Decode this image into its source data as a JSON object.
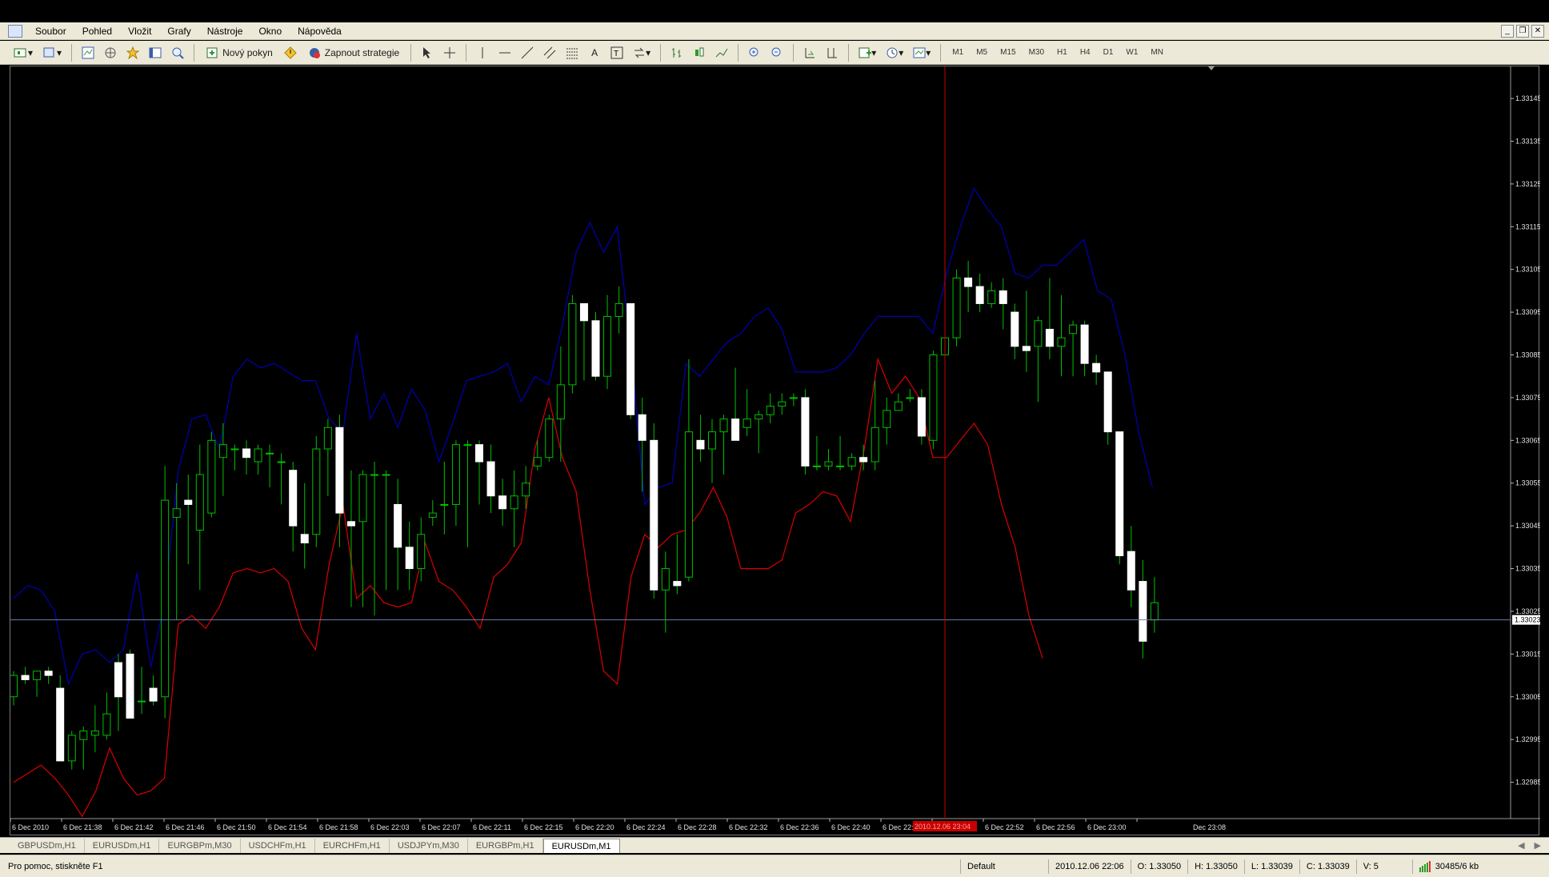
{
  "menubar": {
    "items": [
      "Soubor",
      "Pohled",
      "Vložit",
      "Grafy",
      "Nástroje",
      "Okno",
      "Nápověda"
    ],
    "window_controls": [
      "_",
      "❐",
      "✕"
    ]
  },
  "toolbar": {
    "new_order_label": "Nový pokyn",
    "strategy_label": "Zapnout strategie",
    "timeframes": [
      "M1",
      "M5",
      "M15",
      "M30",
      "H1",
      "H4",
      "D1",
      "W1",
      "MN"
    ]
  },
  "tabs": [
    "GBPUSDm,H1",
    "EURUSDm,H1",
    "EURGBPm,M30",
    "USDCHFm,H1",
    "EURCHFm,H1",
    "USDJPYm,M30",
    "EURGBPm,H1",
    "EURUSDm,M1"
  ],
  "active_tab": 7,
  "status": {
    "help": "Pro pomoc, stiskněte F1",
    "profile": "Default",
    "datetime": "2010.12.06 22:06",
    "open": "O: 1.33050",
    "high": "H: 1.33050",
    "low": "L: 1.33039",
    "close": "C: 1.33039",
    "volume": "V: 5",
    "traffic": "30485/6 kb"
  },
  "colors": {
    "bull_candle": "#00c000",
    "bear_body": "#ffffff",
    "upper_band": "#0000b4",
    "lower_band": "#dc0000",
    "price_line": "#6a7fa8",
    "cursor_line": "#c80000"
  },
  "chart_data": {
    "type": "candlestick",
    "symbol": "EURUSDm",
    "timeframe": "M1",
    "y_ticks": [
      "1.33145",
      "1.33135",
      "1.33125",
      "1.33115",
      "1.33105",
      "1.33095",
      "1.33085",
      "1.33075",
      "1.33065",
      "1.33055",
      "1.33045",
      "1.33035",
      "1.33025",
      "1.33015",
      "1.33005",
      "1.32995",
      "1.32985"
    ],
    "x_ticks": [
      "6 Dec 2010",
      "6 Dec 21:38",
      "6 Dec 21:42",
      "6 Dec 21:46",
      "6 Dec 21:50",
      "6 Dec 21:54",
      "6 Dec 21:58",
      "6 Dec 22:03",
      "6 Dec 22:07",
      "6 Dec 22:11",
      "6 Dec 22:15",
      "6 Dec 22:20",
      "6 Dec 22:24",
      "6 Dec 22:28",
      "6 Dec 22:32",
      "6 Dec 22:36",
      "6 Dec 22:40",
      "6 Dec 22:44",
      "6 Dec 22:48",
      "6 Dec 22:52",
      "6 Dec 22:56",
      "6 Dec 23:00",
      "Dec 23:08"
    ],
    "current_price": "1.33023",
    "cursor_time_label": "2010.12.06 23:04",
    "candles": [
      [
        1.33005,
        1.33011,
        1.33003,
        1.3301
      ],
      [
        1.3301,
        1.33012,
        1.33008,
        1.33009
      ],
      [
        1.33009,
        1.33011,
        1.33005,
        1.33011
      ],
      [
        1.33011,
        1.33012,
        1.33008,
        1.3301
      ],
      [
        1.33007,
        1.3301,
        1.3299,
        1.3299
      ],
      [
        1.3299,
        1.32997,
        1.32988,
        1.32996
      ],
      [
        1.32995,
        1.32998,
        1.32988,
        1.32997
      ],
      [
        1.32996,
        1.33003,
        1.32992,
        1.32997
      ],
      [
        1.32996,
        1.33006,
        1.32995,
        1.33001
      ],
      [
        1.33013,
        1.33015,
        1.32997,
        1.33005
      ],
      [
        1.33015,
        1.33016,
        1.33001,
        1.33
      ],
      [
        1.33004,
        1.33012,
        1.33001,
        1.33004
      ],
      [
        1.33007,
        1.3301,
        1.33003,
        1.33004
      ],
      [
        1.33005,
        1.33059,
        1.33,
        1.33051
      ],
      [
        1.33047,
        1.33055,
        1.33023,
        1.33049
      ],
      [
        1.33051,
        1.33057,
        1.33036,
        1.3305
      ],
      [
        1.33044,
        1.33064,
        1.3303,
        1.33057
      ],
      [
        1.33048,
        1.33067,
        1.33047,
        1.33065
      ],
      [
        1.33061,
        1.33069,
        1.33052,
        1.33064
      ],
      [
        1.33063,
        1.33064,
        1.33058,
        1.33063
      ],
      [
        1.33063,
        1.33065,
        1.33057,
        1.33061
      ],
      [
        1.3306,
        1.33064,
        1.33057,
        1.33063
      ],
      [
        1.33062,
        1.33064,
        1.33054,
        1.33062
      ],
      [
        1.3306,
        1.33062,
        1.3305,
        1.3306
      ],
      [
        1.33058,
        1.3306,
        1.33039,
        1.33045
      ],
      [
        1.33043,
        1.33055,
        1.33035,
        1.33041
      ],
      [
        1.33043,
        1.33066,
        1.3304,
        1.33063
      ],
      [
        1.33063,
        1.3307,
        1.33052,
        1.33068
      ],
      [
        1.33068,
        1.33071,
        1.3304,
        1.33048
      ],
      [
        1.33046,
        1.33058,
        1.33026,
        1.33045
      ],
      [
        1.33046,
        1.33058,
        1.33026,
        1.33057
      ],
      [
        1.33057,
        1.3306,
        1.33024,
        1.33057
      ],
      [
        1.33057,
        1.33058,
        1.3303,
        1.33057
      ],
      [
        1.3305,
        1.33056,
        1.3303,
        1.3304
      ],
      [
        1.3304,
        1.33046,
        1.3303,
        1.33035
      ],
      [
        1.33035,
        1.33047,
        1.33032,
        1.33043
      ],
      [
        1.33047,
        1.33051,
        1.33045,
        1.33048
      ],
      [
        1.3305,
        1.3306,
        1.33043,
        1.3305
      ],
      [
        1.3305,
        1.33065,
        1.33045,
        1.33064
      ],
      [
        1.33064,
        1.33065,
        1.3304,
        1.33064
      ],
      [
        1.33064,
        1.33065,
        1.3305,
        1.3306
      ],
      [
        1.3306,
        1.33064,
        1.33048,
        1.33052
      ],
      [
        1.33052,
        1.33056,
        1.33045,
        1.33049
      ],
      [
        1.33049,
        1.33058,
        1.3304,
        1.33052
      ],
      [
        1.33052,
        1.33059,
        1.33049,
        1.33055
      ],
      [
        1.33059,
        1.33065,
        1.33058,
        1.33061
      ],
      [
        1.33061,
        1.33071,
        1.3306,
        1.3307
      ],
      [
        1.3307,
        1.33087,
        1.3306,
        1.33078
      ],
      [
        1.33078,
        1.33099,
        1.33076,
        1.33097
      ],
      [
        1.33097,
        1.33097,
        1.33079,
        1.33093
      ],
      [
        1.33093,
        1.33095,
        1.33079,
        1.3308
      ],
      [
        1.3308,
        1.33099,
        1.33077,
        1.33094
      ],
      [
        1.33094,
        1.33101,
        1.3309,
        1.33097
      ],
      [
        1.33097,
        1.33097,
        1.3307,
        1.33071
      ],
      [
        1.33071,
        1.33075,
        1.33053,
        1.33065
      ],
      [
        1.33065,
        1.33069,
        1.33028,
        1.3303
      ],
      [
        1.3303,
        1.33039,
        1.3302,
        1.33035
      ],
      [
        1.33032,
        1.33043,
        1.33029,
        1.33031
      ],
      [
        1.33033,
        1.33084,
        1.33032,
        1.33067
      ],
      [
        1.33065,
        1.33071,
        1.3306,
        1.33063
      ],
      [
        1.33063,
        1.3307,
        1.33055,
        1.33067
      ],
      [
        1.33067,
        1.33071,
        1.33057,
        1.3307
      ],
      [
        1.3307,
        1.33082,
        1.33068,
        1.33065
      ],
      [
        1.33068,
        1.33077,
        1.33066,
        1.3307
      ],
      [
        1.3307,
        1.33072,
        1.33062,
        1.33071
      ],
      [
        1.33071,
        1.33076,
        1.33069,
        1.33073
      ],
      [
        1.33073,
        1.33076,
        1.33071,
        1.33074
      ],
      [
        1.33075,
        1.33076,
        1.33073,
        1.33075
      ],
      [
        1.33075,
        1.33077,
        1.33057,
        1.33059
      ],
      [
        1.33059,
        1.33066,
        1.33058,
        1.33059
      ],
      [
        1.33059,
        1.33063,
        1.33058,
        1.3306
      ],
      [
        1.33059,
        1.33066,
        1.33058,
        1.33059
      ],
      [
        1.33059,
        1.33062,
        1.33058,
        1.33061
      ],
      [
        1.33061,
        1.33064,
        1.33058,
        1.3306
      ],
      [
        1.3306,
        1.33079,
        1.33058,
        1.33068
      ],
      [
        1.33068,
        1.33075,
        1.33064,
        1.33072
      ],
      [
        1.33072,
        1.33076,
        1.33073,
        1.33074
      ],
      [
        1.33075,
        1.33077,
        1.33074,
        1.33075
      ],
      [
        1.33075,
        1.33077,
        1.33064,
        1.33066
      ],
      [
        1.33065,
        1.33086,
        1.33063,
        1.33085
      ],
      [
        1.33085,
        1.33092,
        1.33076,
        1.33089
      ],
      [
        1.33089,
        1.33105,
        1.33087,
        1.33103
      ],
      [
        1.33103,
        1.33107,
        1.33095,
        1.33101
      ],
      [
        1.33101,
        1.33104,
        1.33095,
        1.33097
      ],
      [
        1.33097,
        1.33102,
        1.33096,
        1.331
      ],
      [
        1.331,
        1.33103,
        1.33091,
        1.33097
      ],
      [
        1.33095,
        1.33097,
        1.33084,
        1.33087
      ],
      [
        1.33087,
        1.331,
        1.33081,
        1.33086
      ],
      [
        1.33087,
        1.33094,
        1.33074,
        1.33093
      ],
      [
        1.33091,
        1.33103,
        1.33084,
        1.33087
      ],
      [
        1.33087,
        1.33099,
        1.3308,
        1.33089
      ],
      [
        1.3309,
        1.33093,
        1.3308,
        1.33092
      ],
      [
        1.33092,
        1.33093,
        1.3308,
        1.33083
      ],
      [
        1.33083,
        1.33085,
        1.33078,
        1.33081
      ],
      [
        1.33081,
        1.33081,
        1.33064,
        1.33067
      ],
      [
        1.33067,
        1.33067,
        1.33036,
        1.33038
      ],
      [
        1.33039,
        1.33045,
        1.33026,
        1.3303
      ],
      [
        1.33032,
        1.33037,
        1.33014,
        1.33018
      ],
      [
        1.33023,
        1.33033,
        1.3302,
        1.33027
      ]
    ],
    "upper_band": [
      1.33028,
      1.33031,
      1.3303,
      1.33025,
      1.33008,
      1.33015,
      1.33016,
      1.33013,
      1.33016,
      1.33034,
      1.33012,
      1.33027,
      1.33058,
      1.3307,
      1.33071,
      1.33063,
      1.3308,
      1.33084,
      1.33082,
      1.33083,
      1.33081,
      1.33079,
      1.33079,
      1.3307,
      1.33067,
      1.3309,
      1.3307,
      1.33076,
      1.33068,
      1.33077,
      1.33072,
      1.3306,
      1.33069,
      1.33079,
      1.3308,
      1.33081,
      1.33083,
      1.33074,
      1.3308,
      1.33078,
      1.33092,
      1.33109,
      1.33116,
      1.33109,
      1.33115,
      1.33086,
      1.3305,
      1.33054,
      1.33055,
      1.33083,
      1.3308,
      1.33084,
      1.33088,
      1.3309,
      1.33094,
      1.33096,
      1.33091,
      1.33081,
      1.33081,
      1.33081,
      1.33082,
      1.33085,
      1.3309,
      1.33094,
      1.33094,
      1.33094,
      1.33094,
      1.3309,
      1.33104,
      1.33115,
      1.33124,
      1.33119,
      1.33115,
      1.33104,
      1.33103,
      1.33106,
      1.33106,
      1.33109,
      1.33112,
      1.331,
      1.33098,
      1.33085,
      1.33067,
      1.33054
    ],
    "lower_band": [
      1.32985,
      1.32987,
      1.32989,
      1.32986,
      1.32982,
      1.32977,
      1.32983,
      1.32993,
      1.32986,
      1.32982,
      1.32983,
      1.32986,
      1.33022,
      1.33024,
      1.33021,
      1.33026,
      1.33034,
      1.33035,
      1.33034,
      1.33035,
      1.33032,
      1.33021,
      1.33016,
      1.33036,
      1.3305,
      1.33028,
      1.33031,
      1.33027,
      1.33026,
      1.33027,
      1.33041,
      1.33032,
      1.3303,
      1.33026,
      1.33021,
      1.33033,
      1.33036,
      1.33041,
      1.33063,
      1.33075,
      1.33061,
      1.33053,
      1.3303,
      1.33011,
      1.33008,
      1.33033,
      1.33043,
      1.3304,
      1.33043,
      1.33044,
      1.33048,
      1.33054,
      1.33047,
      1.33035,
      1.33035,
      1.33035,
      1.33037,
      1.33048,
      1.3305,
      1.33053,
      1.33052,
      1.33046,
      1.33063,
      1.33084,
      1.33076,
      1.3308,
      1.33075,
      1.33061,
      1.33061,
      1.33065,
      1.33069,
      1.33064,
      1.3305,
      1.3304,
      1.33024,
      1.33014
    ]
  }
}
